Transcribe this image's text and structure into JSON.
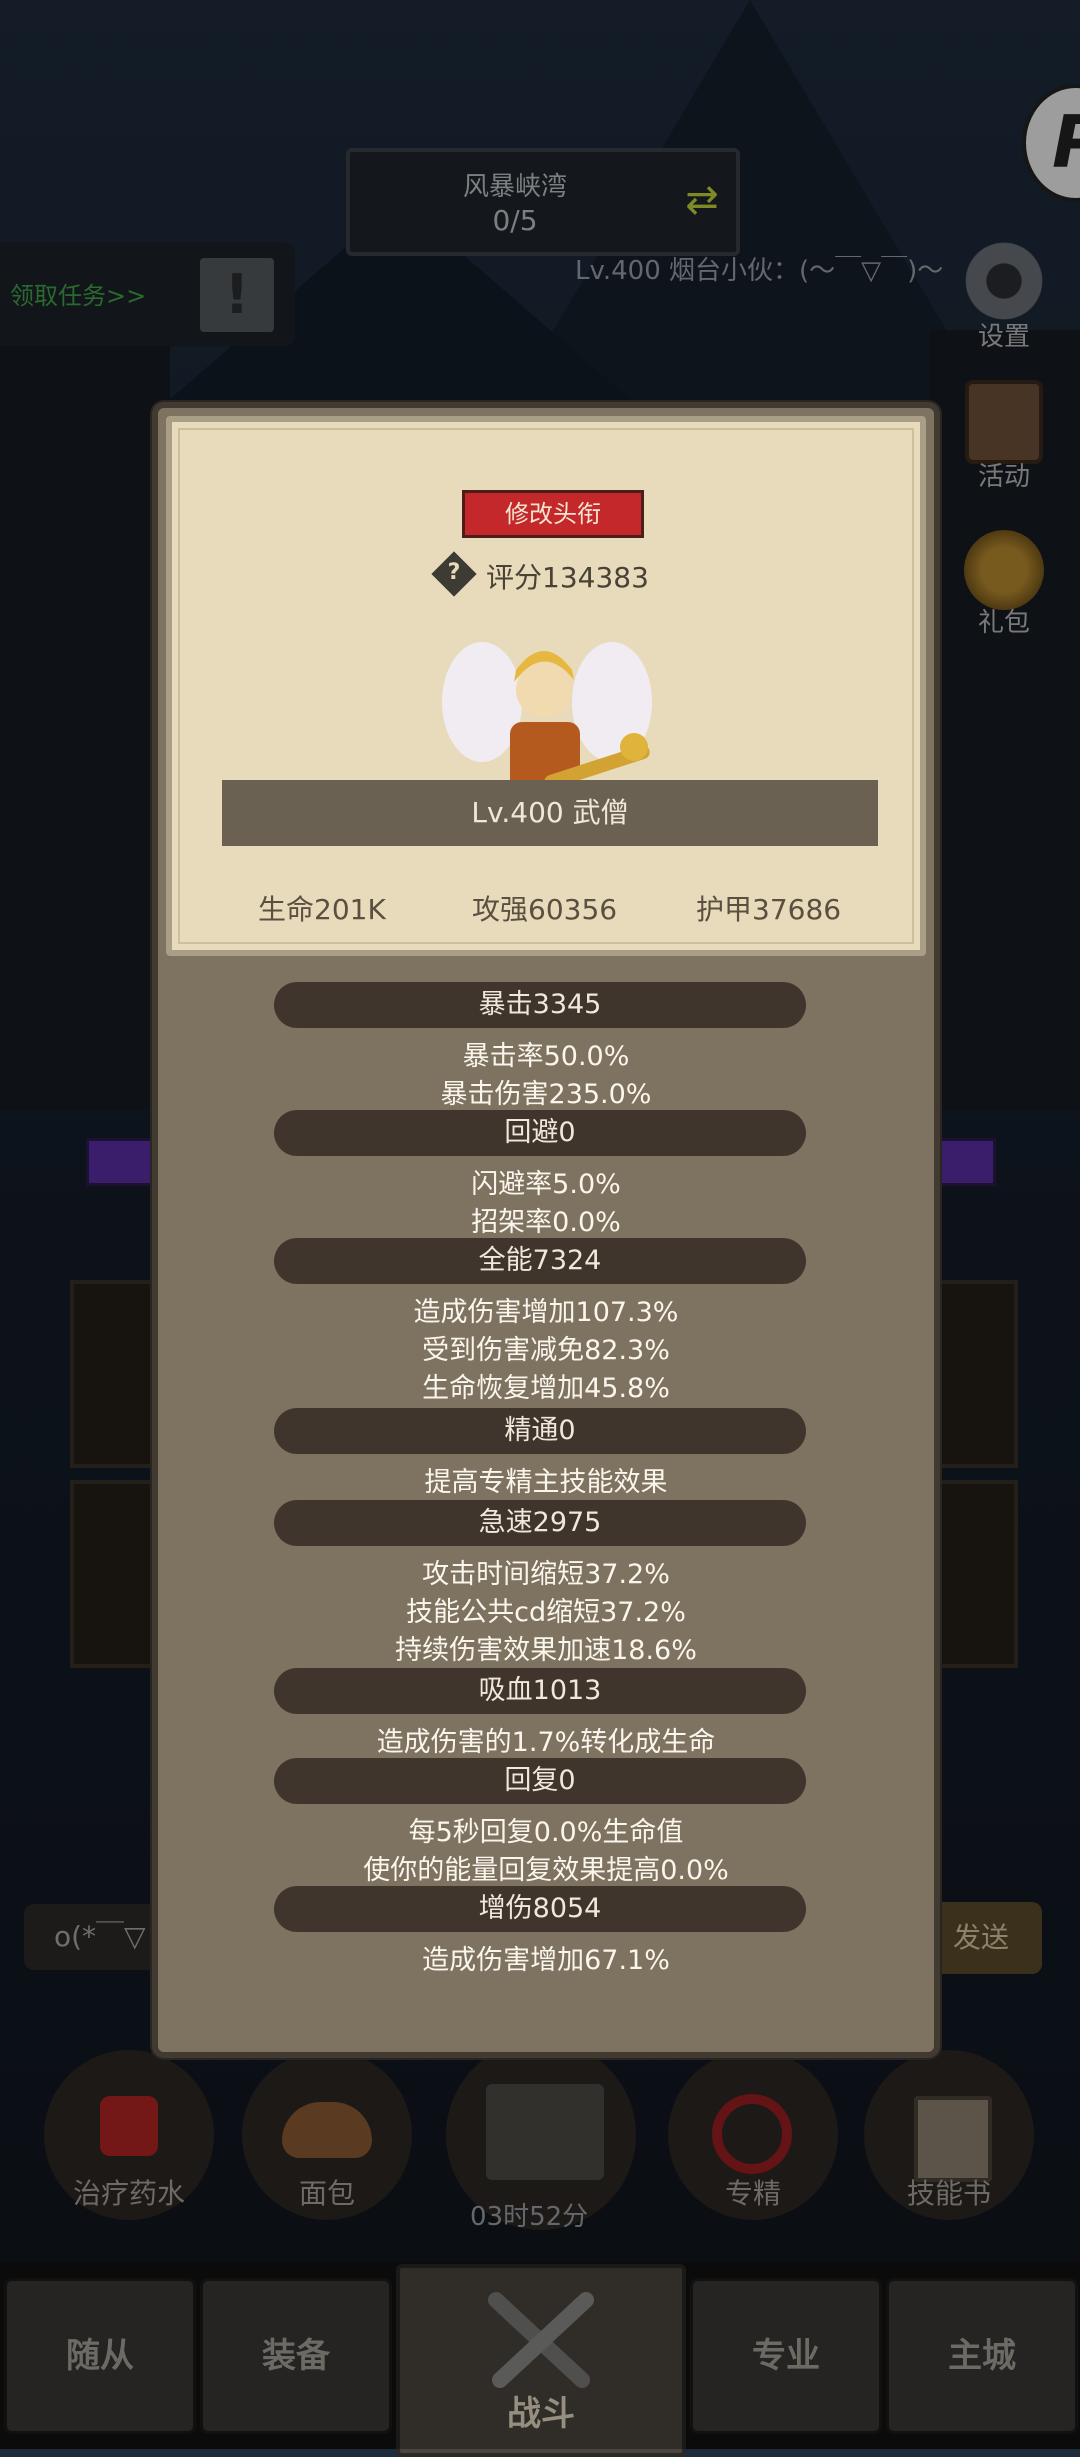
{
  "top": {
    "stage_name": "风暴峡湾",
    "stage_count": "0/5",
    "quest_label": "领取任务>>",
    "quest_alert": "!",
    "player_line": "Lv.400 烟台小伙：(～￣▽￣)～"
  },
  "side_buttons": [
    {
      "label": "设置",
      "icon": "gear-icon"
    },
    {
      "label": "活动",
      "icon": "scroll-icon"
    },
    {
      "label": "礼包",
      "icon": "gift-pot-icon"
    }
  ],
  "chat": {
    "input_text": "o(*￣▽",
    "send_label": "发送"
  },
  "items": [
    {
      "label": "治疗药水",
      "icon": "potion-icon"
    },
    {
      "label": "面包",
      "icon": "bread-icon"
    },
    {
      "label": "",
      "icon": "treasure-chest-icon"
    },
    {
      "label": "专精",
      "icon": "specialization-icon"
    },
    {
      "label": "技能书",
      "icon": "skill-book-icon"
    }
  ],
  "timer": "03时52分",
  "nav": {
    "tabs": [
      "随从",
      "装备",
      "专业",
      "主城"
    ],
    "center_label": "战斗"
  },
  "popup": {
    "edit_title_label": "修改头衔",
    "score": "评分134383",
    "level_class": "Lv.400 武僧",
    "base_stats": [
      "生命201K",
      "攻强60356",
      "护甲37686"
    ],
    "groups": [
      {
        "header": "暴击3345",
        "lines": [
          "暴击率50.0%",
          "暴击伤害235.0%"
        ]
      },
      {
        "header": "回避0",
        "lines": [
          "闪避率5.0%",
          "招架率0.0%"
        ]
      },
      {
        "header": "全能7324",
        "lines": [
          "造成伤害增加107.3%",
          "受到伤害减免82.3%",
          "生命恢复增加45.8%"
        ]
      },
      {
        "header": "精通0",
        "lines": [
          "提高专精主技能效果"
        ]
      },
      {
        "header": "急速2975",
        "lines": [
          "攻击时间缩短37.2%",
          "技能公共cd缩短37.2%",
          "持续伤害效果加速18.6%"
        ]
      },
      {
        "header": "吸血1013",
        "lines": [
          "造成伤害的1.7%转化成生命"
        ]
      },
      {
        "header": "回复0",
        "lines": [
          "每5秒回复0.0%生命值",
          "使你的能量回复效果提高0.0%"
        ]
      },
      {
        "header": "增伤8054",
        "lines": [
          "造成伤害增加67.1%"
        ]
      }
    ]
  },
  "colors": {
    "edit_button": "#c5282a",
    "quest_green": "#3fa34a",
    "stat_header_bg": "#3f352c"
  }
}
